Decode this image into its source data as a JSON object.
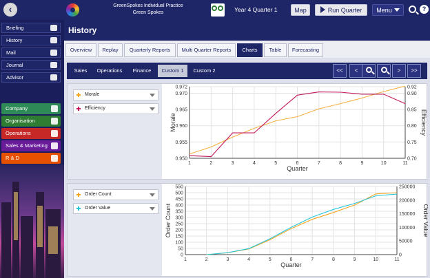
{
  "header": {
    "org_title": "GreenSpokes Individual Practice",
    "org_subtitle": "Green Spokes",
    "period": "Year 4 Quarter 1",
    "map_label": "Map",
    "run_quarter_label": "Run Quarter",
    "menu_label": "Menu",
    "help_label": "?"
  },
  "sidebar": {
    "items": [
      {
        "label": "Briefing",
        "icon": "people-icon"
      },
      {
        "label": "History",
        "icon": "history-icon"
      },
      {
        "label": "Mail",
        "icon": "mail-icon"
      },
      {
        "label": "Journal",
        "icon": "pencil-icon"
      },
      {
        "label": "Advisor",
        "icon": "lightbulb-icon"
      }
    ],
    "departments": [
      {
        "label": "Company",
        "color": "#2e8b57",
        "icon": "gears-icon"
      },
      {
        "label": "Organisation",
        "color": "#2e7d32",
        "icon": "clipboard-icon"
      },
      {
        "label": "Operations",
        "color": "#c62828",
        "icon": "factory-icon"
      },
      {
        "label": "Sales & Marketing",
        "color": "#6a1b9a",
        "icon": "bar-chart-icon"
      },
      {
        "label": "R & D",
        "color": "#e65100",
        "icon": "microscope-icon"
      }
    ]
  },
  "page": {
    "title": "History",
    "tabs": [
      "Overview",
      "Replay",
      "Quarterly Reports",
      "Multi Quarter Reports",
      "Charts",
      "Table",
      "Forecasting"
    ],
    "active_tab": "Charts",
    "subtabs": [
      "Sales",
      "Operations",
      "Finance",
      "Custom 1",
      "Custom 2"
    ],
    "active_subtab": "Custom 1",
    "nav_buttons": [
      "<<",
      "<",
      "zoom-in",
      "zoom-out",
      ">",
      ">>"
    ]
  },
  "panels": [
    {
      "selectors": [
        {
          "label": "Morale",
          "color": "#f5a623"
        },
        {
          "label": "Efficiency",
          "color": "#c2185b"
        }
      ]
    },
    {
      "selectors": [
        {
          "label": "Order Count",
          "color": "#f5a623"
        },
        {
          "label": "Order Value",
          "color": "#26c6da"
        }
      ]
    }
  ],
  "chart_data": [
    {
      "type": "line",
      "xlabel": "Quarter",
      "ylabel": "Morale",
      "y2label": "Efficiency",
      "x": [
        1,
        2,
        3,
        4,
        5,
        6,
        7,
        8,
        9,
        10,
        11
      ],
      "xticks": [
        "1",
        "2",
        "3",
        "4",
        "5",
        "6",
        "7",
        "8",
        "9",
        "10",
        "11"
      ],
      "ylim": [
        0.95,
        0.972
      ],
      "yticks": [
        "0.950",
        "0.955",
        "0.960",
        "0.965",
        "0.970",
        "0.972"
      ],
      "y2lim": [
        0.7,
        0.92
      ],
      "y2ticks": [
        "0.70",
        "0.75",
        "0.80",
        "0.85",
        "0.90",
        "0.92"
      ],
      "grid": true,
      "series": [
        {
          "name": "Morale",
          "axis": "left",
          "color": "#f5b041",
          "values": [
            0.9513,
            0.9535,
            0.9565,
            0.9592,
            0.9615,
            0.9628,
            0.9652,
            0.9668,
            0.9685,
            0.9705,
            0.9722
          ]
        },
        {
          "name": "Efficiency",
          "axis": "right",
          "color": "#c2185b",
          "values": [
            0.708,
            0.705,
            0.778,
            0.778,
            0.838,
            0.894,
            0.904,
            0.903,
            0.897,
            0.897,
            0.868
          ]
        }
      ]
    },
    {
      "type": "line",
      "xlabel": "Quarter",
      "ylabel": "Order Count",
      "y2label": "Order Value",
      "x": [
        1,
        2,
        3,
        4,
        5,
        6,
        7,
        8,
        9,
        10,
        11
      ],
      "xticks": [
        "1",
        "2",
        "3",
        "4",
        "5",
        "6",
        "7",
        "8",
        "9",
        "10",
        "11"
      ],
      "ylim": [
        0,
        550
      ],
      "yticks": [
        "0",
        "50",
        "100",
        "150",
        "200",
        "250",
        "300",
        "350",
        "400",
        "450",
        "500",
        "550"
      ],
      "y2lim": [
        0,
        250000
      ],
      "y2ticks": [
        "0",
        "50000",
        "100000",
        "150000",
        "200000",
        "250000"
      ],
      "grid": true,
      "series": [
        {
          "name": "Order Count",
          "axis": "left",
          "color": "#f5a623",
          "values": [
            null,
            0,
            15,
            45,
            120,
            210,
            285,
            340,
            400,
            490,
            500
          ]
        },
        {
          "name": "Order Value",
          "axis": "right",
          "color": "#26c6da",
          "values": [
            null,
            0,
            7000,
            22000,
            58000,
            100000,
            138000,
            166000,
            188000,
            216000,
            222000
          ]
        }
      ]
    }
  ]
}
